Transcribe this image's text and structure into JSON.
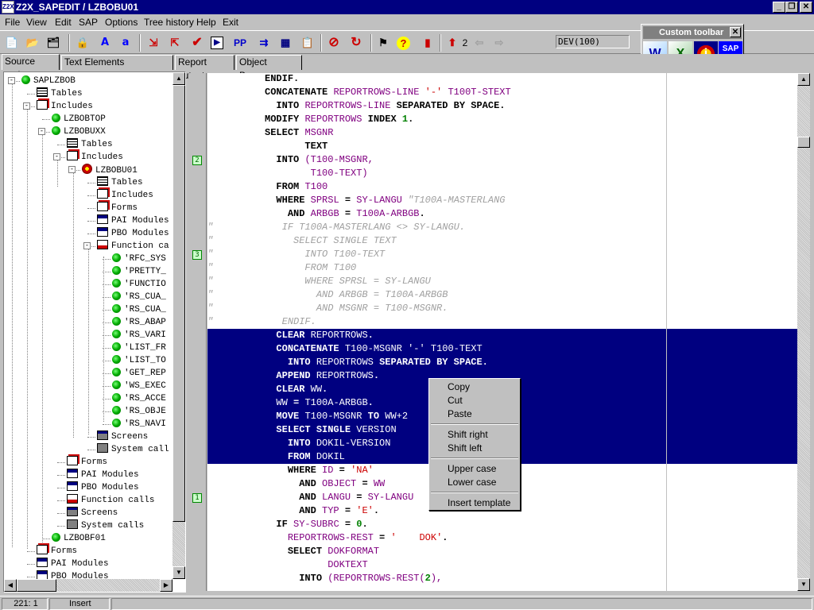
{
  "window": {
    "title": "Z2X_SAPEDIT / LZBOBU01",
    "icon": "sap-app-icon",
    "controls": [
      "_",
      "❐",
      "✕"
    ]
  },
  "menu": [
    "File",
    "View",
    "Edit",
    "SAP",
    "Options",
    "Tree history",
    "Help",
    "Exit"
  ],
  "toolbar": {
    "buttons": [
      {
        "name": "new-icon",
        "glyph": "📄"
      },
      {
        "name": "open-icon",
        "glyph": "📂"
      },
      {
        "name": "tree-icon",
        "glyph": "🗂"
      },
      {
        "name": "lock-icon",
        "glyph": "🔒"
      },
      {
        "name": "uppercase-a-icon",
        "glyph": "A"
      },
      {
        "name": "lowercase-a-icon",
        "glyph": "a"
      },
      {
        "name": "import-icon",
        "glyph": "⇲"
      },
      {
        "name": "export-icon",
        "glyph": "⇱"
      },
      {
        "name": "check-icon",
        "glyph": "✔"
      },
      {
        "name": "run-icon",
        "glyph": "▶"
      },
      {
        "name": "pretty-printer-icon",
        "glyph": "PP"
      },
      {
        "name": "where-used-icon",
        "glyph": "⇉"
      },
      {
        "name": "table-icon",
        "glyph": "▦"
      },
      {
        "name": "clipboard-icon",
        "glyph": "📋"
      },
      {
        "name": "stop-icon",
        "glyph": "⊘"
      },
      {
        "name": "refresh-icon",
        "glyph": "↻"
      },
      {
        "name": "settings-icon",
        "glyph": "⚑"
      },
      {
        "name": "help-icon",
        "glyph": "?"
      },
      {
        "name": "exit-icon",
        "glyph": "▮"
      },
      {
        "name": "up-arrow-icon",
        "glyph": "⬆"
      },
      {
        "name": "back-arrow-icon",
        "glyph": "⇦"
      },
      {
        "name": "forward-arrow-icon",
        "glyph": "⇨"
      }
    ],
    "history_count": "2",
    "system": "DEV(100)"
  },
  "custom_toolbar": {
    "title": "Custom toolbar",
    "close": "✕",
    "buttons": [
      {
        "name": "word-icon",
        "glyph": "W"
      },
      {
        "name": "excel-icon",
        "glyph": "X"
      },
      {
        "name": "info-icon",
        "glyph": "i"
      },
      {
        "name": "sap-edit-icon",
        "glyph": "SAP Edit"
      }
    ]
  },
  "tabs": [
    {
      "label": "Source code",
      "active": true
    },
    {
      "label": "Text Elements (SAPLZBOB)",
      "active": false
    },
    {
      "label": "Report output",
      "active": false
    },
    {
      "label": "Object Browser",
      "active": false
    }
  ],
  "tree": [
    {
      "label": "SAPLZBOB",
      "icon": "ball",
      "level": 0,
      "toggle": "-"
    },
    {
      "label": "Tables",
      "icon": "table",
      "level": 1
    },
    {
      "label": "Includes",
      "icon": "doc",
      "level": 1,
      "toggle": "-"
    },
    {
      "label": "LZBOBTOP",
      "icon": "ball",
      "level": 2
    },
    {
      "label": "LZBOBUXX",
      "icon": "ball",
      "level": 2,
      "toggle": "-"
    },
    {
      "label": "Tables",
      "icon": "table",
      "level": 3
    },
    {
      "label": "Includes",
      "icon": "doc",
      "level": 3,
      "toggle": "-"
    },
    {
      "label": "LZBOBU01",
      "icon": "target",
      "level": 4,
      "toggle": "-"
    },
    {
      "label": "Tables",
      "icon": "table",
      "level": 5
    },
    {
      "label": "Includes",
      "icon": "doc",
      "level": 5
    },
    {
      "label": "Forms",
      "icon": "doc",
      "level": 5
    },
    {
      "label": "PAI Modules",
      "icon": "pai",
      "level": 5
    },
    {
      "label": "PBO Modules",
      "icon": "pai",
      "level": 5
    },
    {
      "label": "Function ca",
      "icon": "func",
      "level": 5,
      "toggle": "-"
    },
    {
      "label": "'RFC_SYS",
      "icon": "ball",
      "level": 6
    },
    {
      "label": "'PRETTY_",
      "icon": "ball",
      "level": 6
    },
    {
      "label": "'FUNCTIO",
      "icon": "ball",
      "level": 6
    },
    {
      "label": "'RS_CUA_",
      "icon": "ball",
      "level": 6
    },
    {
      "label": "'RS_CUA_",
      "icon": "ball",
      "level": 6
    },
    {
      "label": "'RS_ABAP",
      "icon": "ball",
      "level": 6
    },
    {
      "label": "'RS_VARI",
      "icon": "ball",
      "level": 6
    },
    {
      "label": "'LIST_FR",
      "icon": "ball",
      "level": 6
    },
    {
      "label": "'LIST_TO",
      "icon": "ball",
      "level": 6
    },
    {
      "label": "'GET_REP",
      "icon": "ball",
      "level": 6
    },
    {
      "label": "'WS_EXEC",
      "icon": "ball",
      "level": 6
    },
    {
      "label": "'RS_ACCE",
      "icon": "ball",
      "level": 6
    },
    {
      "label": "'RS_OBJE",
      "icon": "ball",
      "level": 6
    },
    {
      "label": "'RS_NAVI",
      "icon": "ball",
      "level": 6
    },
    {
      "label": "Screens",
      "icon": "screen",
      "level": 5
    },
    {
      "label": "System call",
      "icon": "sys",
      "level": 5
    },
    {
      "label": "Forms",
      "icon": "doc",
      "level": 3
    },
    {
      "label": "PAI Modules",
      "icon": "pai",
      "level": 3
    },
    {
      "label": "PBO Modules",
      "icon": "pai",
      "level": 3
    },
    {
      "label": "Function calls",
      "icon": "func",
      "level": 3
    },
    {
      "label": "Screens",
      "icon": "screen",
      "level": 3
    },
    {
      "label": "System calls",
      "icon": "sys",
      "level": 3
    },
    {
      "label": "LZBOBF01",
      "icon": "ball",
      "level": 2
    },
    {
      "label": "Forms",
      "icon": "doc",
      "level": 1
    },
    {
      "label": "PAI Modules",
      "icon": "pai",
      "level": 1
    },
    {
      "label": "PBO Modules",
      "icon": "pai",
      "level": 1
    }
  ],
  "breakpoints": [
    {
      "label": "2",
      "line": 6
    },
    {
      "label": "3",
      "line": 13
    },
    {
      "label": "1",
      "line": 31
    }
  ],
  "code": [
    [
      [
        "",
        "          "
      ],
      [
        "kw",
        "ENDIF."
      ]
    ],
    [
      [
        "",
        "          "
      ],
      [
        "kw",
        "CONCATENATE "
      ],
      [
        "id",
        "REPORTROWS-LINE "
      ],
      [
        "str",
        "'-'"
      ],
      [
        "",
        " "
      ],
      [
        "id",
        "T100T-STEXT"
      ]
    ],
    [
      [
        "",
        "            "
      ],
      [
        "kw",
        "INTO "
      ],
      [
        "id",
        "REPORTROWS-LINE "
      ],
      [
        "kw",
        "SEPARATED BY SPACE."
      ]
    ],
    [
      [
        "",
        "          "
      ],
      [
        "kw",
        "MODIFY "
      ],
      [
        "id",
        "REPORTROWS "
      ],
      [
        "kw",
        "INDEX "
      ],
      [
        "num",
        "1"
      ],
      [
        "kw",
        "."
      ]
    ],
    [
      [
        "",
        "          "
      ],
      [
        "kw",
        "SELECT "
      ],
      [
        "id",
        "MSGNR"
      ]
    ],
    [
      [
        "",
        "                 "
      ],
      [
        "kw",
        "TEXT"
      ]
    ],
    [
      [
        "",
        "            "
      ],
      [
        "kw",
        "INTO "
      ],
      [
        "id",
        "(T100-MSGNR,"
      ]
    ],
    [
      [
        "",
        "                  "
      ],
      [
        "id",
        "T100-TEXT)"
      ]
    ],
    [
      [
        "",
        "            "
      ],
      [
        "kw",
        "FROM "
      ],
      [
        "id",
        "T100"
      ]
    ],
    [
      [
        "",
        "            "
      ],
      [
        "kw",
        "WHERE "
      ],
      [
        "id",
        "SPRSL "
      ],
      [
        "kw",
        "= "
      ],
      [
        "id",
        "SY-LANGU "
      ],
      [
        "cm",
        "\"T100A-MASTERLANG"
      ]
    ],
    [
      [
        "",
        "              "
      ],
      [
        "kw",
        "AND "
      ],
      [
        "id",
        "ARBGB "
      ],
      [
        "kw",
        "= "
      ],
      [
        "id",
        "T100A-ARBGB"
      ],
      [
        "kw",
        "."
      ]
    ],
    [
      [
        "cm",
        "\"            IF T100A-MASTERLANG <> SY-LANGU."
      ]
    ],
    [
      [
        "cm",
        "\"              SELECT SINGLE TEXT"
      ]
    ],
    [
      [
        "cm",
        "\"                INTO T100-TEXT"
      ]
    ],
    [
      [
        "cm",
        "\"                FROM T100"
      ]
    ],
    [
      [
        "cm",
        "\"                WHERE SPRSL = SY-LANGU"
      ]
    ],
    [
      [
        "cm",
        "\"                  AND ARBGB = T100A-ARBGB"
      ]
    ],
    [
      [
        "cm",
        "\"                  AND MSGNR = T100-MSGNR."
      ]
    ],
    [
      [
        "cm",
        "\"            ENDIF."
      ]
    ],
    [
      [
        "",
        "            "
      ],
      [
        "kw",
        "CLEAR "
      ],
      [
        "id",
        "REPORTROWS"
      ],
      [
        "kw",
        "."
      ]
    ],
    [
      [
        "",
        "            "
      ],
      [
        "kw",
        "CONCATENATE "
      ],
      [
        "id",
        "T100-MSGNR "
      ],
      [
        "str",
        "'-'"
      ],
      [
        "",
        " "
      ],
      [
        "id",
        "T100-TEXT"
      ]
    ],
    [
      [
        "",
        "              "
      ],
      [
        "kw",
        "INTO "
      ],
      [
        "id",
        "REPORTROWS "
      ],
      [
        "kw",
        "SEPARATED BY SPACE."
      ]
    ],
    [
      [
        "",
        "            "
      ],
      [
        "kw",
        "APPEND "
      ],
      [
        "id",
        "REPORTROWS"
      ],
      [
        "kw",
        "."
      ]
    ],
    [
      [
        "",
        "            "
      ],
      [
        "kw",
        "CLEAR "
      ],
      [
        "id",
        "WW"
      ],
      [
        "kw",
        "."
      ]
    ],
    [
      [
        "",
        "            "
      ],
      [
        "id",
        "WW "
      ],
      [
        "kw",
        "= "
      ],
      [
        "id",
        "T100A-ARBGB"
      ],
      [
        "kw",
        "."
      ]
    ],
    [
      [
        "",
        "            "
      ],
      [
        "kw",
        "MOVE "
      ],
      [
        "id",
        "T100-MSGNR "
      ],
      [
        "kw",
        "TO "
      ],
      [
        "id",
        "WW+2"
      ]
    ],
    [
      [
        "",
        "            "
      ],
      [
        "kw",
        "SELECT SINGLE "
      ],
      [
        "id",
        "VERSION"
      ]
    ],
    [
      [
        "",
        "              "
      ],
      [
        "kw",
        "INTO "
      ],
      [
        "id",
        "DOKIL-VERSION"
      ]
    ],
    [
      [
        "",
        "              "
      ],
      [
        "kw",
        "FROM "
      ],
      [
        "id",
        "DOKIL"
      ]
    ],
    [
      [
        "",
        "              "
      ],
      [
        "kw",
        "WHERE "
      ],
      [
        "id",
        "ID "
      ],
      [
        "kw",
        "= "
      ],
      [
        "str",
        "'NA'"
      ]
    ],
    [
      [
        "",
        "                "
      ],
      [
        "kw",
        "AND "
      ],
      [
        "id",
        "OBJECT "
      ],
      [
        "kw",
        "= "
      ],
      [
        "id",
        "WW"
      ]
    ],
    [
      [
        "",
        "                "
      ],
      [
        "kw",
        "AND "
      ],
      [
        "id",
        "LANGU "
      ],
      [
        "kw",
        "= "
      ],
      [
        "id",
        "SY-LANGU"
      ]
    ],
    [
      [
        "",
        "                "
      ],
      [
        "kw",
        "AND "
      ],
      [
        "id",
        "TYP "
      ],
      [
        "kw",
        "= "
      ],
      [
        "str",
        "'E'"
      ],
      [
        "kw",
        "."
      ]
    ],
    [
      [
        "",
        "            "
      ],
      [
        "kw",
        "IF "
      ],
      [
        "id",
        "SY-SUBRC "
      ],
      [
        "kw",
        "= "
      ],
      [
        "num",
        "0"
      ],
      [
        "kw",
        "."
      ]
    ],
    [
      [
        "",
        "              "
      ],
      [
        "id",
        "REPORTROWS-REST "
      ],
      [
        "kw",
        "= "
      ],
      [
        "str",
        "'    DOK'"
      ],
      [
        "kw",
        "."
      ]
    ],
    [
      [
        "",
        "              "
      ],
      [
        "kw",
        "SELECT "
      ],
      [
        "id",
        "DOKFORMAT"
      ]
    ],
    [
      [
        "",
        "                     "
      ],
      [
        "id",
        "DOKTEXT"
      ]
    ],
    [
      [
        "",
        "                "
      ],
      [
        "kw",
        "INTO "
      ],
      [
        "id",
        "(REPORTROWS-REST("
      ],
      [
        "num",
        "2"
      ],
      [
        "id",
        "),"
      ]
    ]
  ],
  "selected_lines": [
    19,
    28
  ],
  "context_menu": {
    "items": [
      {
        "label": "Copy",
        "group": 0
      },
      {
        "label": "Cut",
        "group": 0
      },
      {
        "label": "Paste",
        "group": 0
      },
      {
        "label": "Shift right",
        "group": 1
      },
      {
        "label": "Shift left",
        "group": 1
      },
      {
        "label": "Upper case",
        "group": 2
      },
      {
        "label": "Lower case",
        "group": 2
      },
      {
        "label": "Insert template",
        "group": 3
      }
    ]
  },
  "status": {
    "position": "221: 1",
    "mode": "Insert"
  }
}
